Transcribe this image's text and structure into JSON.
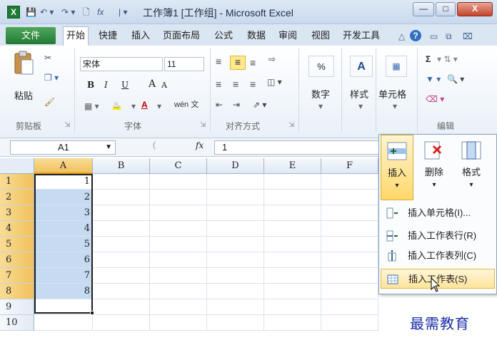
{
  "window": {
    "logo": "X",
    "title": "工作簿1  [工作组] - Microsoft Excel",
    "quick_access": [
      "save-icon",
      "undo-icon",
      "redo-icon",
      "new-icon",
      "fx-icon"
    ],
    "fx": "fx",
    "controls": {
      "minimize": "—",
      "maximize": "□",
      "close": "X"
    }
  },
  "tabs": {
    "file": "文件",
    "items": [
      "开始",
      "快捷",
      "插入",
      "页面布局",
      "公式",
      "数据",
      "审阅",
      "视图",
      "开发工具"
    ],
    "active": "开始"
  },
  "ribbon": {
    "clipboard": {
      "paste": "粘贴",
      "label": "剪贴板"
    },
    "font": {
      "name": "宋体",
      "size": "11",
      "label": "字体",
      "bold": "B",
      "italic": "I",
      "underline": "U",
      "grow": "A",
      "shrink": "A",
      "color_a": "A",
      "wen": "wén 文"
    },
    "alignment": {
      "label": "对齐方式"
    },
    "number": {
      "percent": "%",
      "label": "数字"
    },
    "styles": {
      "label": "样式"
    },
    "cells": {
      "label": "单元格"
    },
    "editing": {
      "label": "编辑",
      "sigma": "Σ"
    }
  },
  "formula_bar": {
    "name_box": "A1",
    "fx": "fx",
    "value": "1"
  },
  "sheet": {
    "columns": [
      "A",
      "B",
      "C",
      "D",
      "E",
      "F"
    ],
    "rows": [
      "1",
      "2",
      "3",
      "4",
      "5",
      "6",
      "7",
      "8",
      "9",
      "10"
    ],
    "a_values": [
      "1",
      "2",
      "3",
      "4",
      "5",
      "6",
      "7",
      "8",
      "",
      ""
    ]
  },
  "insert_menu": {
    "buttons": {
      "insert": "插入",
      "delete": "删除",
      "format": "格式"
    },
    "items": [
      {
        "label": "插入单元格(I)..."
      },
      {
        "label": "插入工作表行(R)"
      },
      {
        "label": "插入工作表列(C)"
      },
      {
        "label": "插入工作表(S)"
      }
    ]
  },
  "watermark": "最需教育",
  "colors": {
    "accent": "#1d7a35",
    "selection": "#c6dbf1",
    "header_selected": "#f1c15c",
    "menu_hover": "#fde49a"
  }
}
